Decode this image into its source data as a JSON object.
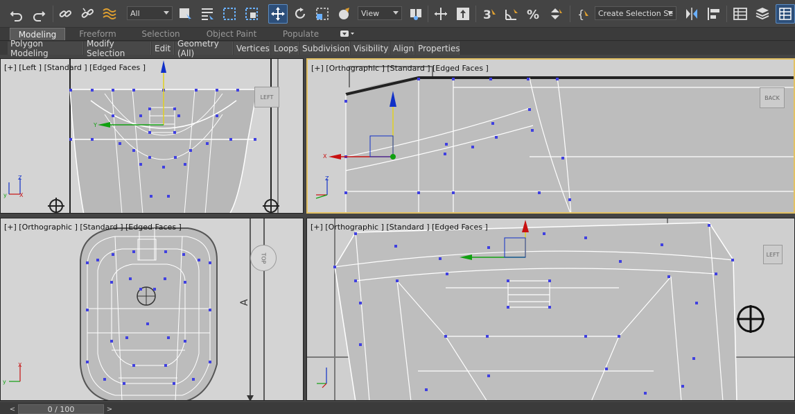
{
  "toolbar": {
    "selection_filter": "All",
    "coord_system": "View",
    "named_selection": "Create Selection Se",
    "icons": [
      "undo-icon",
      "redo-icon",
      "link-icon",
      "unlink-icon",
      "bind-spacewarp-icon",
      "select-object-icon",
      "select-by-name-icon",
      "rect-selection-icon",
      "window-crossing-icon",
      "move-icon",
      "rotate-icon",
      "scale-icon",
      "place-icon",
      "mirror-icon",
      "align-icon",
      "snap-3d-icon",
      "angle-snap-icon",
      "percent-snap-icon",
      "spinner-snap-icon",
      "edit-named-selection-icon",
      "mirror-tool-icon",
      "align-tool-icon",
      "layer-explorer-icon",
      "scene-explorer-icon",
      "ribbon-icon"
    ]
  },
  "ribbon": {
    "tabs": [
      "Modeling",
      "Freeform",
      "Selection",
      "Object Paint",
      "Populate"
    ],
    "active": "Modeling"
  },
  "subtabs": [
    "Polygon Modeling",
    "Modify Selection",
    "Edit",
    "Geometry (All)",
    "Vertices",
    "Loops",
    "Subdivision",
    "Visibility",
    "Align",
    "Properties"
  ],
  "viewports": {
    "top_left": {
      "label": "[+] [Left ] [Standard ] [Edged Faces ]",
      "cube": "LEFT"
    },
    "top_right": {
      "label": "[+] [Orthographic ] [Standard ] [Edged Faces ]",
      "cube": "BACK"
    },
    "bottom_left": {
      "label": "[+] [Orthographic ] [Standard ] [Edged Faces ]",
      "cube": "TOP"
    },
    "bottom_right": {
      "label": "[+] [Orthographic ] [Standard ] [Edged Faces ]",
      "cube": "LEFT"
    }
  },
  "timeline": {
    "frame": "0 / 100",
    "prev": "<",
    "next": ">"
  },
  "colors": {
    "active_border": "#e3c162",
    "vertex": "#3b3bd8",
    "x_axis": "#c81010",
    "y_axis": "#10a010",
    "z_axis": "#1030c8"
  }
}
